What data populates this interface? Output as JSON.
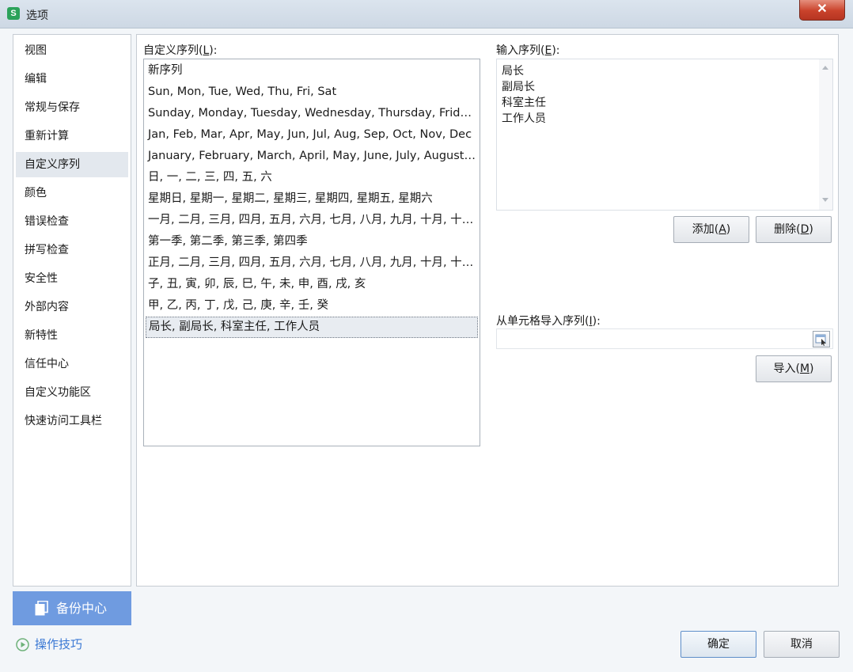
{
  "window": {
    "title": "选项",
    "app_icon_letter": "S",
    "close_glyph": "✕"
  },
  "sidebar": {
    "items": [
      {
        "label": "视图"
      },
      {
        "label": "编辑"
      },
      {
        "label": "常规与保存"
      },
      {
        "label": "重新计算"
      },
      {
        "label": "自定义序列",
        "active": true
      },
      {
        "label": "颜色"
      },
      {
        "label": "错误检查"
      },
      {
        "label": "拼写检查"
      },
      {
        "label": "安全性"
      },
      {
        "label": "外部内容"
      },
      {
        "label": "新特性"
      },
      {
        "label": "信任中心"
      },
      {
        "label": "自定义功能区"
      },
      {
        "label": "快速访问工具栏"
      }
    ],
    "backup_label": "备份中心",
    "tips_label": "操作技巧"
  },
  "custom_lists": {
    "label_prefix": "自定义序列(",
    "label_key": "L",
    "label_suffix": "):",
    "items": [
      "新序列",
      "Sun, Mon, Tue, Wed, Thu, Fri, Sat",
      "Sunday, Monday, Tuesday, Wednesday, Thursday, Friday, Saturday",
      "Jan, Feb, Mar, Apr, May, Jun, Jul, Aug, Sep, Oct, Nov, Dec",
      "January, February, March, April, May, June, July, August, September, October, November, December",
      "日, 一, 二, 三, 四, 五, 六",
      "星期日, 星期一, 星期二, 星期三, 星期四, 星期五, 星期六",
      "一月, 二月, 三月, 四月, 五月, 六月, 七月, 八月, 九月, 十月, 十一月, 十二月",
      "第一季, 第二季, 第三季, 第四季",
      "正月, 二月, 三月, 四月, 五月, 六月, 七月, 八月, 九月, 十月, 十一月, 腊月",
      "子, 丑, 寅, 卯, 辰, 巳, 午, 未, 申, 酉, 戌, 亥",
      "甲, 乙, 丙, 丁, 戊, 己, 庚, 辛, 壬, 癸",
      "局长, 副局长, 科室主任, 工作人员"
    ],
    "selected_index": 12
  },
  "entries": {
    "label_prefix": "输入序列(",
    "label_key": "E",
    "label_suffix": "):",
    "lines": [
      "局长",
      "副局长",
      "科室主任",
      "工作人员"
    ]
  },
  "buttons": {
    "add_prefix": "添加(",
    "add_key": "A",
    "delete_prefix": "删除(",
    "delete_key": "D",
    "import_prefix": "导入(",
    "import_key": "M",
    "close_paren": ")",
    "ok": "确定",
    "cancel": "取消"
  },
  "import_from_cells": {
    "label_prefix": "从单元格导入序列(",
    "label_key": "I",
    "label_suffix": "):",
    "value": ""
  },
  "colors": {
    "accent": "#6f9be0",
    "link": "#3a78d4",
    "selected_bg": "#e8ecf1"
  }
}
